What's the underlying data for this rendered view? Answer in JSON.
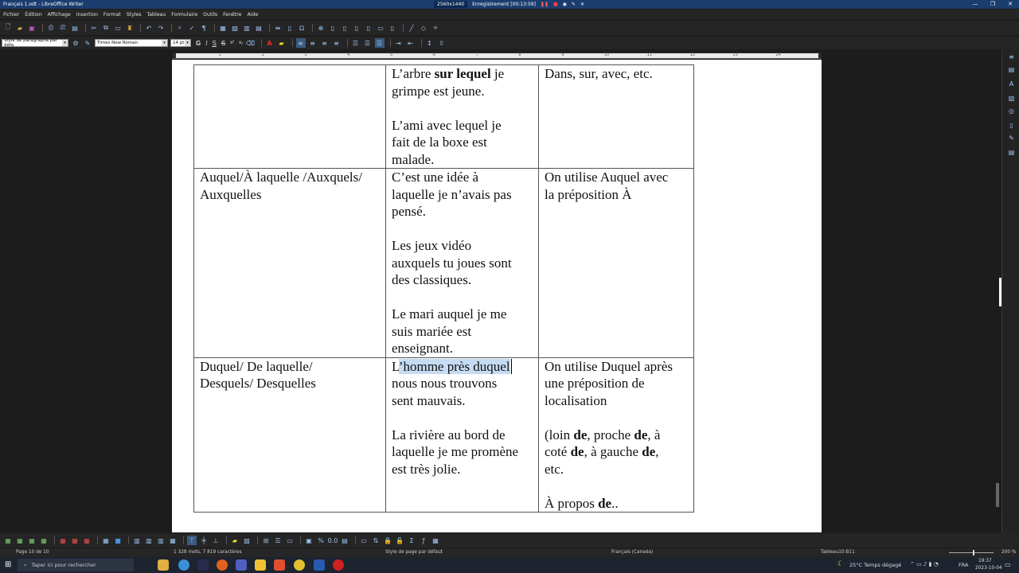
{
  "window": {
    "title": "Français 1.odt - LibreOffice Writer",
    "recording_resolution": "2560x1440",
    "recording_status": "Enregistrement [00:13:59]"
  },
  "menu": [
    "Fichier",
    "Édition",
    "Affichage",
    "Insertion",
    "Format",
    "Styles",
    "Tableau",
    "Formulaire",
    "Outils",
    "Fenêtre",
    "Aide"
  ],
  "format_toolbar": {
    "paragraph_style": "Style de paragraphe par défa",
    "font_name": "Times New Roman",
    "font_size": "14 pt",
    "bold": "G",
    "italic": "I",
    "underline": "S",
    "strike": "S",
    "superscript": "x²",
    "subscript": "x₂"
  },
  "ruler": {
    "labels": [
      "1",
      "2",
      "3",
      "4",
      "5",
      "6",
      "7",
      "8",
      "9",
      "10",
      "11",
      "12",
      "13",
      "14"
    ]
  },
  "table": {
    "row1": {
      "col2": {
        "l1a": "L’arbre ",
        "l1b": "sur lequel",
        "l1c": " je",
        "l2": "grimpe est jeune.",
        "l3": "L’ami avec lequel je",
        "l4": "fait de la boxe est",
        "l5": "malade."
      },
      "col3": {
        "l1": "Dans, sur, avec, etc."
      }
    },
    "row2": {
      "col1": {
        "l1": "Auquel/À laquelle /Auxquels/",
        "l2": "Auxquelles"
      },
      "col2": {
        "l1": "C’est une idée à",
        "l2": "laquelle je n’avais pas",
        "l3": "pensé.",
        "l4": "Les jeux vidéo",
        "l5": "auxquels tu joues sont",
        "l6": "des classiques.",
        "l7": "Le mari auquel je me",
        "l8": "suis mariée est",
        "l9": "enseignant."
      },
      "col3": {
        "l1": "On utilise Auquel avec",
        "l2": "la préposition À"
      }
    },
    "row3": {
      "col1": {
        "l1": "Duquel/ De laquelle/",
        "l2": "Desquels/ Desquelles"
      },
      "col2": {
        "l1a": "L",
        "l1b": "’homme près duquel",
        "l2": "nous nous trouvons",
        "l3": "sent mauvais.",
        "l4": "La rivière au bord de",
        "l5": "laquelle je me promène",
        "l6": "est très jolie."
      },
      "col3": {
        "l1": "On utilise Duquel après",
        "l2": "une préposition de",
        "l3": "localisation",
        "l4a": "(loin ",
        "l4b": "de",
        "l4c": ", proche ",
        "l4d": "de",
        "l4e": ", à",
        "l5a": "coté ",
        "l5b": "de",
        "l5c": ", à gauche ",
        "l5d": "de",
        "l5e": ",",
        "l6": "etc.",
        "l7a": "À propos ",
        "l7b": "de",
        "l7c": ".."
      }
    }
  },
  "status": {
    "page": "Page 10 de 10",
    "words": "1 328 mots, 7 819 caractères",
    "page_style": "Style de page par défaut",
    "language": "Français (Canada)",
    "table_cell": "Tableau10:B11",
    "zoom": "200 %"
  },
  "taskbar": {
    "search_placeholder": "Taper ici pour rechercher",
    "weather": "25°C  Temps dégagé",
    "lang": "FRA",
    "time": "19:37",
    "date": "2023-10-04"
  },
  "colors": {
    "titlebar": "#1a3d6e",
    "selection": "#c5dbf2",
    "toolbar_bg": "#252525"
  }
}
